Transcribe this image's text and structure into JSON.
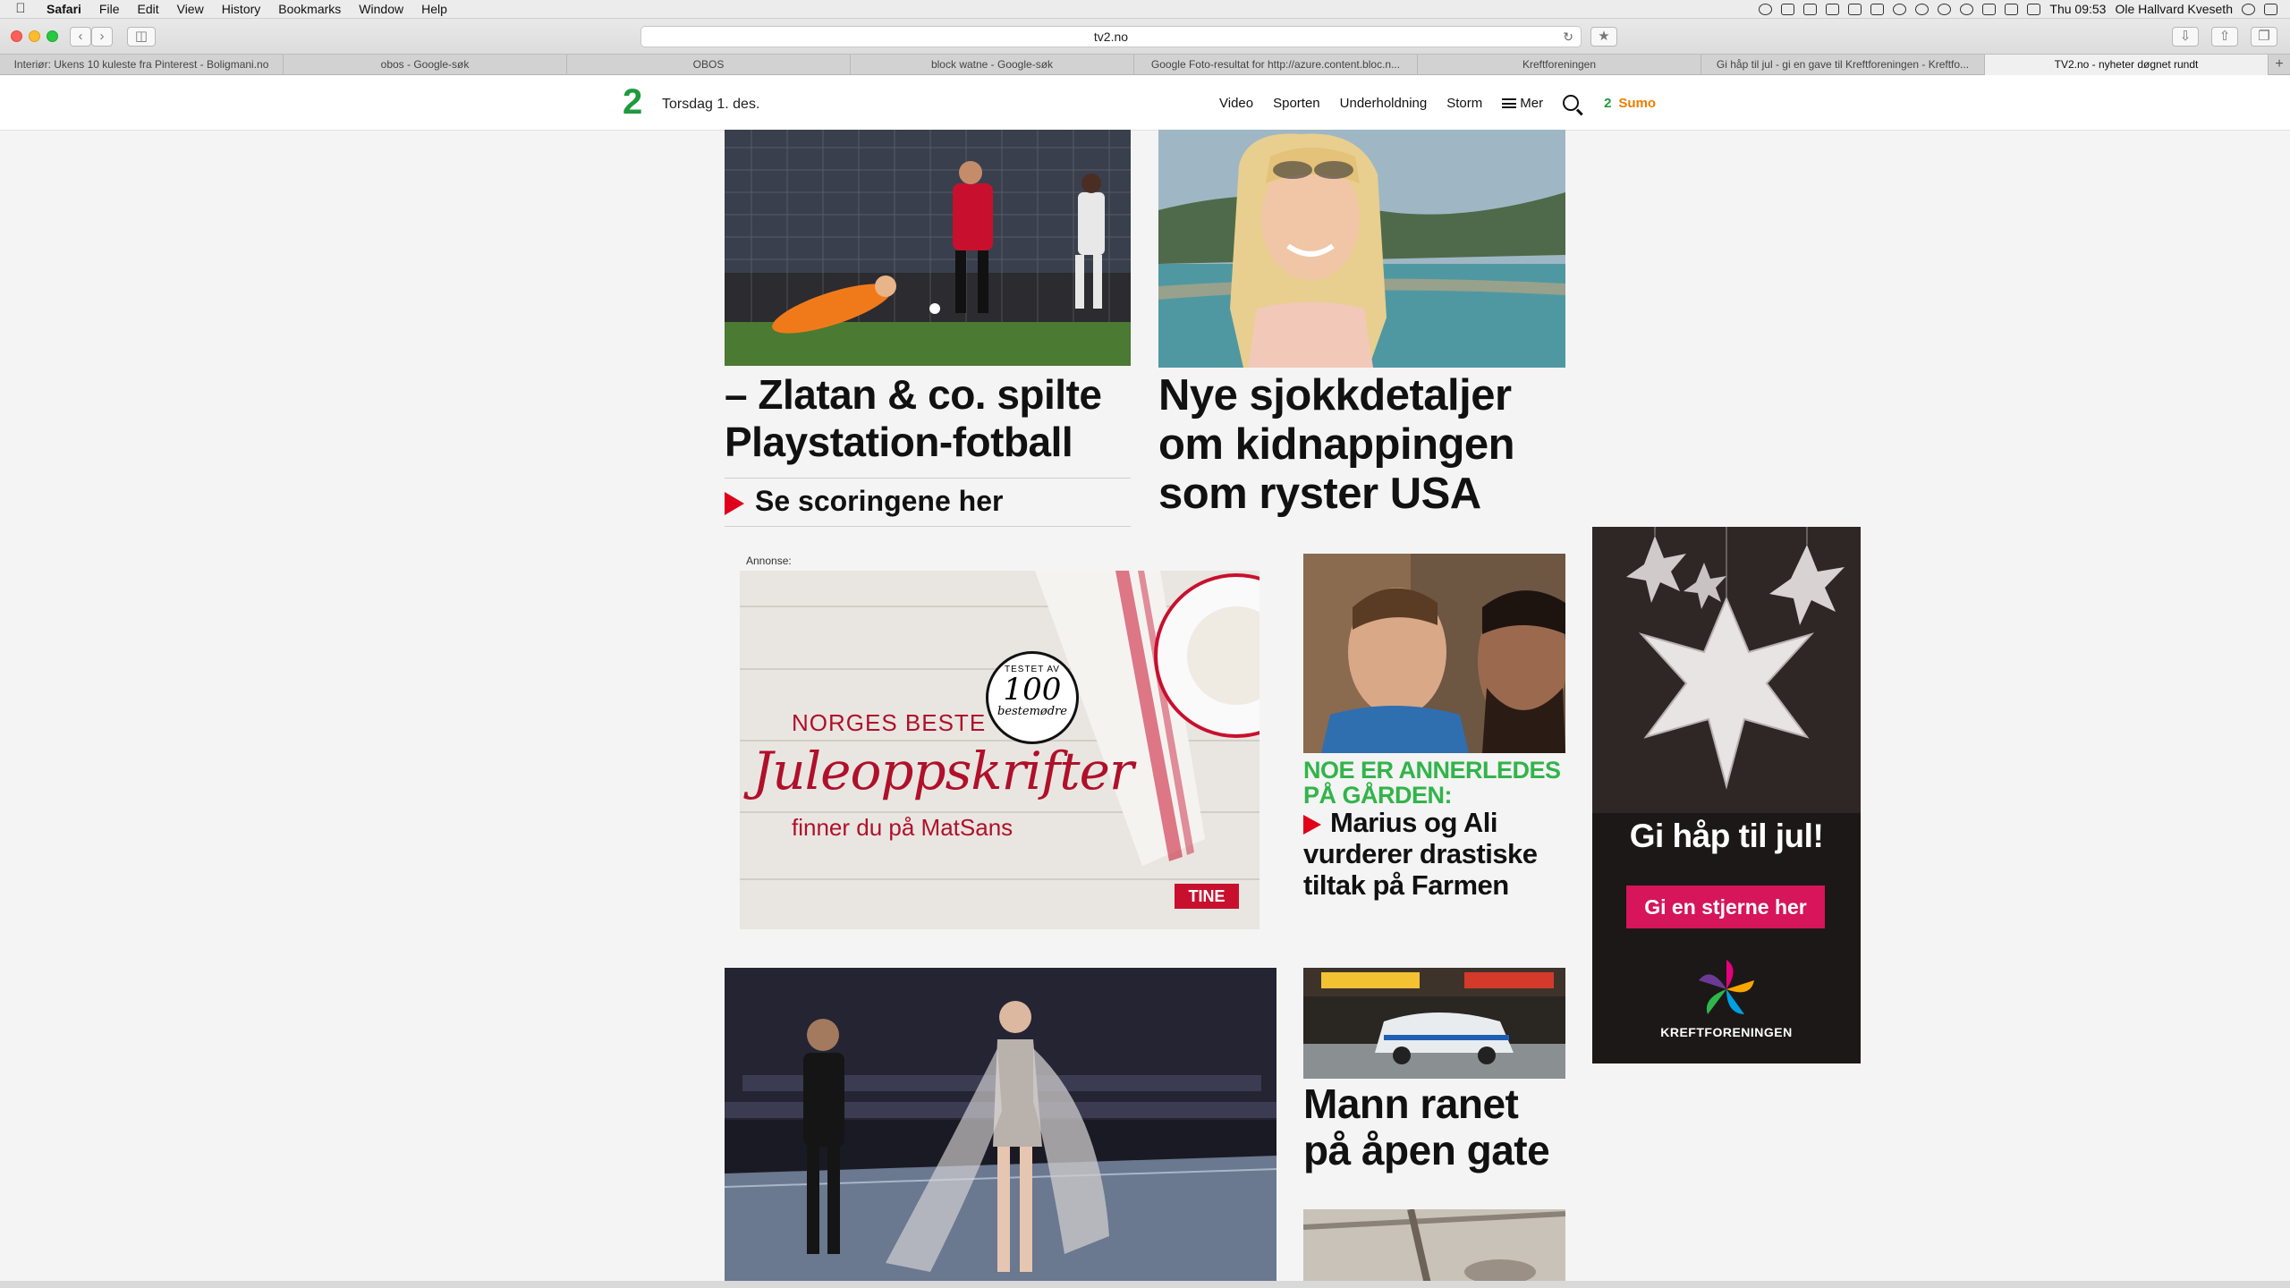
{
  "browser": {
    "menu": {
      "app": "Safari",
      "items": [
        "File",
        "Edit",
        "View",
        "History",
        "Bookmarks",
        "Window",
        "Help"
      ],
      "clock": "Thu 09:53",
      "user": "Ole Hallvard Kveseth"
    },
    "url": "tv2.no",
    "tabs": [
      {
        "title": "Interiør: Ukens 10 kuleste fra Pinterest - Boligmani.no",
        "active": false
      },
      {
        "title": "obos - Google-søk",
        "active": false
      },
      {
        "title": "OBOS",
        "active": false
      },
      {
        "title": "block watne - Google-søk",
        "active": false
      },
      {
        "title": "Google Foto-resultat for http://azure.content.bloc.n...",
        "active": false
      },
      {
        "title": "Kreftforeningen",
        "active": false
      },
      {
        "title": "Gi håp til jul - gi en gave til Kreftforeningen - Kreftfo...",
        "active": false
      },
      {
        "title": "TV2.no - nyheter døgnet rundt",
        "active": true
      }
    ],
    "new_tab": "+"
  },
  "site": {
    "logo": "2",
    "date": "Torsdag 1. des.",
    "nav": {
      "video": "Video",
      "sporten": "Sporten",
      "underholdning": "Underholdning",
      "storm": "Storm",
      "mer": "Mer",
      "sumo_num": "2",
      "sumo": "Sumo"
    }
  },
  "articles": {
    "football": {
      "headline_1": "– Zlatan & co. spilte",
      "headline_2": "Playstation-fotball",
      "sub": "Se scoringene her"
    },
    "kidnap": {
      "headline_1": "Nye sjokkdetaljer",
      "headline_2": "om kidnappingen",
      "headline_3": "som ryster USA"
    },
    "farmen": {
      "kicker_1": "NOE ER ANNERLEDES",
      "kicker_2": "PÅ GÅRDEN:",
      "headline_1": "Marius og Ali",
      "headline_2": "vurderer drastiske",
      "headline_3": "tiltak på Farmen"
    },
    "ran": {
      "headline_1": "Mann ranet",
      "headline_2": "på åpen gate"
    }
  },
  "ads": {
    "label": "Annonse:",
    "tine": {
      "stamp_top": "TESTET AV",
      "stamp_num": "100",
      "stamp_bottom": "bestemødre",
      "line1": "NORGES BESTE",
      "line2": "Juleoppskrifter",
      "line3": "finner du på MatSans",
      "brand": "TINE"
    },
    "kreft": {
      "title": "Gi håp til jul!",
      "button": "Gi en stjerne her",
      "brand": "KREFTFORENINGEN"
    }
  },
  "colors": {
    "accent_red": "#e0001b",
    "kicker_green": "#32b44a",
    "sumo_orange": "#ee7d00",
    "kreft_pink": "#d6155a"
  }
}
